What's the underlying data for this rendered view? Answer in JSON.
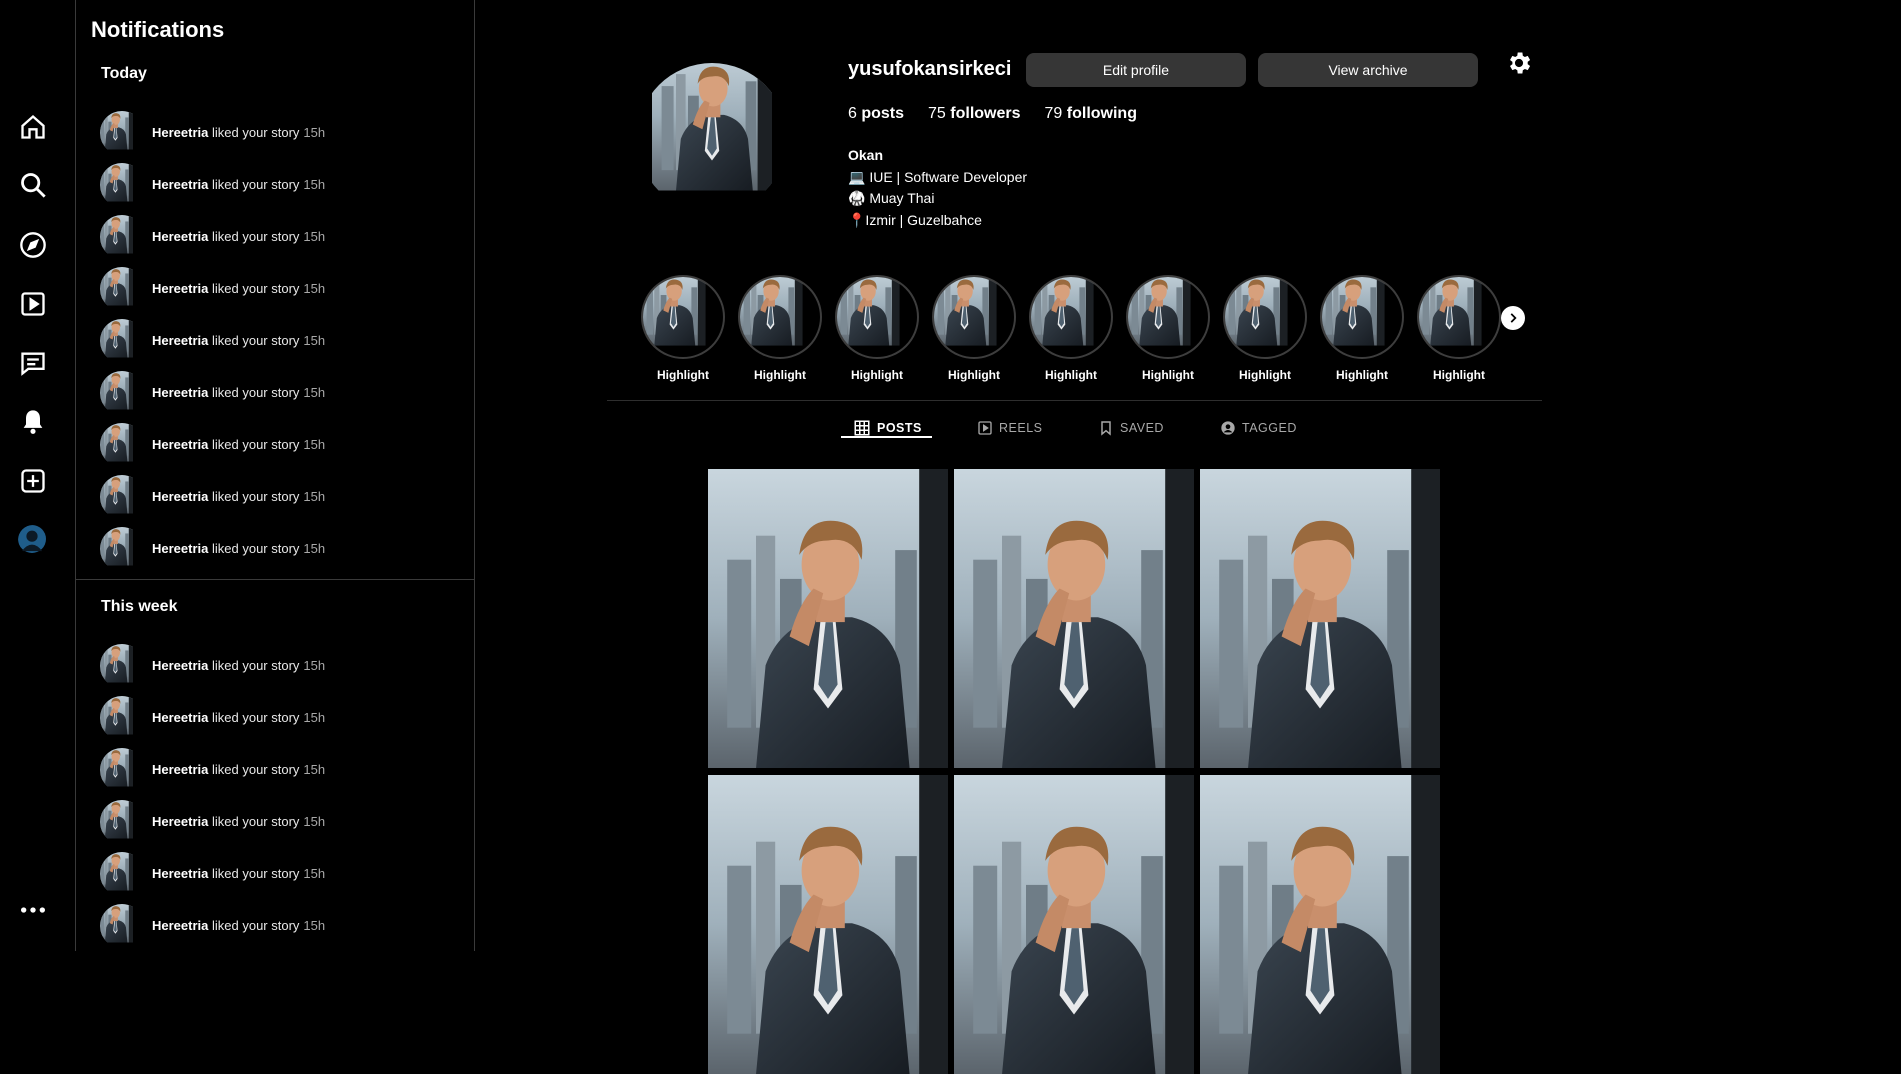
{
  "rail": {
    "icons": [
      "home-icon",
      "search-icon",
      "explore-icon",
      "reels-icon",
      "messages-icon",
      "notifications-icon",
      "create-icon",
      "profile-avatar",
      "more-icon"
    ]
  },
  "notifications": {
    "title": "Notifications",
    "today_label": "Today",
    "week_label": "This week",
    "today": [
      {
        "user": "Hereetria",
        "action": "liked your story",
        "time": "15h"
      },
      {
        "user": "Hereetria",
        "action": "liked your story",
        "time": "15h"
      },
      {
        "user": "Hereetria",
        "action": "liked your story",
        "time": "15h"
      },
      {
        "user": "Hereetria",
        "action": "liked your story",
        "time": "15h"
      },
      {
        "user": "Hereetria",
        "action": "liked your story",
        "time": "15h"
      },
      {
        "user": "Hereetria",
        "action": "liked your story",
        "time": "15h"
      },
      {
        "user": "Hereetria",
        "action": "liked your story",
        "time": "15h"
      },
      {
        "user": "Hereetria",
        "action": "liked your story",
        "time": "15h"
      },
      {
        "user": "Hereetria",
        "action": "liked your story",
        "time": "15h"
      }
    ],
    "week": [
      {
        "user": "Hereetria",
        "action": "liked your story",
        "time": "15h"
      },
      {
        "user": "Hereetria",
        "action": "liked your story",
        "time": "15h"
      },
      {
        "user": "Hereetria",
        "action": "liked your story",
        "time": "15h"
      },
      {
        "user": "Hereetria",
        "action": "liked your story",
        "time": "15h"
      },
      {
        "user": "Hereetria",
        "action": "liked your story",
        "time": "15h"
      },
      {
        "user": "Hereetria",
        "action": "liked your story",
        "time": "15h"
      }
    ]
  },
  "profile": {
    "username": "yusufokansirkeci",
    "edit_label": "Edit profile",
    "archive_label": "View archive",
    "posts_count": "6",
    "posts_label": "posts",
    "followers_count": "75",
    "followers_label": "followers",
    "following_count": "79",
    "following_label": "following",
    "name": "Okan",
    "bio_lines": [
      "💻 IUE | Software Developer",
      "🥋 Muay Thai",
      "📍Izmir | Guzelbahce"
    ]
  },
  "highlights": [
    "Highlight",
    "Highlight",
    "Highlight",
    "Highlight",
    "Highlight",
    "Highlight",
    "Highlight",
    "Highlight",
    "Highlight"
  ],
  "tabs": [
    {
      "label": "POSTS",
      "icon": "grid-icon",
      "active": true
    },
    {
      "label": "REELS",
      "icon": "reels-icon",
      "active": false
    },
    {
      "label": "SAVED",
      "icon": "bookmark-icon",
      "active": false
    },
    {
      "label": "TAGGED",
      "icon": "tagged-icon",
      "active": false
    }
  ],
  "posts": 6,
  "colors": {
    "background": "#000000",
    "button": "#363636",
    "muted": "#a8a8a8"
  }
}
